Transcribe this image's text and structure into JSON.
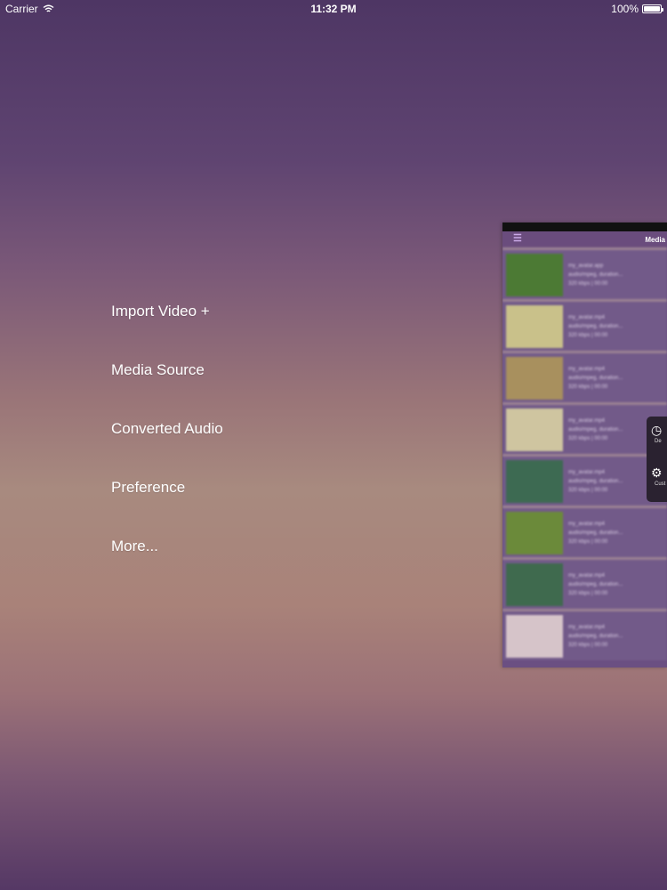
{
  "status_bar": {
    "carrier": "Carrier",
    "time": "11:32 PM",
    "battery": "100%"
  },
  "menu": {
    "items": [
      {
        "label": "Import Video +"
      },
      {
        "label": "Media Source"
      },
      {
        "label": "Converted Audio"
      },
      {
        "label": "Preference"
      },
      {
        "label": "More..."
      }
    ]
  },
  "preview": {
    "title": "Media",
    "rows": [
      {
        "thumb_color": "#4c7a34",
        "l1": "my_avatar.app",
        "l2": "audio/mpeg, duration...",
        "l3": "320 kbps | 00:00"
      },
      {
        "thumb_color": "#c9c18a",
        "l1": "my_avatar.mp4",
        "l2": "audio/mpeg, duration...",
        "l3": "320 kbps | 00:00"
      },
      {
        "thumb_color": "#a8905e",
        "l1": "my_avatar.mp4",
        "l2": "audio/mpeg, duration...",
        "l3": "320 kbps | 00:00"
      },
      {
        "thumb_color": "#cfc5a0",
        "l1": "my_avatar.mp4",
        "l2": "audio/mpeg, duration...",
        "l3": "320 kbps | 00:00"
      },
      {
        "thumb_color": "#3d6a52",
        "l1": "my_avatar.mp4",
        "l2": "audio/mpeg, duration...",
        "l3": "320 kbps | 00:00"
      },
      {
        "thumb_color": "#6b8a3a",
        "l1": "my_avatar.mp4",
        "l2": "audio/mpeg, duration...",
        "l3": "320 kbps | 00:00"
      },
      {
        "thumb_color": "#3f6a4e",
        "l1": "my_avatar.mp4",
        "l2": "audio/mpeg, duration...",
        "l3": "320 kbps | 00:00"
      },
      {
        "thumb_color": "#d6c4c9",
        "l1": "my_avatar.mp4",
        "l2": "audio/mpeg, duration...",
        "l3": "320 kbps | 00:00"
      }
    ],
    "tools": [
      {
        "icon": "clock-icon",
        "label": "De"
      },
      {
        "icon": "gear-icon",
        "label": "Cust"
      }
    ]
  }
}
